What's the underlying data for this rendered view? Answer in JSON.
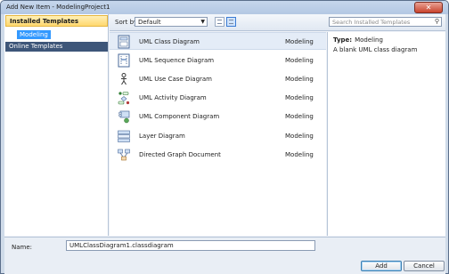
{
  "window": {
    "title": "Add New Item - ModelingProject1",
    "close_glyph": "✕"
  },
  "left": {
    "installed_header": "Installed Templates",
    "tree_item": "Modeling",
    "online_header": "Online Templates"
  },
  "toolbar": {
    "sort_label": "Sort by:",
    "sort_value": "Default",
    "search_placeholder": "Search Installed Templates"
  },
  "templates": [
    {
      "name": "UML Class Diagram",
      "category": "Modeling",
      "icon": "class-diagram-icon"
    },
    {
      "name": "UML Sequence Diagram",
      "category": "Modeling",
      "icon": "sequence-diagram-icon"
    },
    {
      "name": "UML Use Case Diagram",
      "category": "Modeling",
      "icon": "use-case-diagram-icon"
    },
    {
      "name": "UML Activity Diagram",
      "category": "Modeling",
      "icon": "activity-diagram-icon"
    },
    {
      "name": "UML Component Diagram",
      "category": "Modeling",
      "icon": "component-diagram-icon"
    },
    {
      "name": "Layer Diagram",
      "category": "Modeling",
      "icon": "layer-diagram-icon"
    },
    {
      "name": "Directed Graph Document",
      "category": "Modeling",
      "icon": "directed-graph-icon"
    }
  ],
  "details": {
    "type_label": "Type:",
    "type_value": "Modeling",
    "description": "A blank UML class diagram"
  },
  "bottom": {
    "name_label": "Name:",
    "name_value": "UMLClassDiagram1.classdiagram",
    "add_label": "Add",
    "cancel_label": "Cancel"
  }
}
